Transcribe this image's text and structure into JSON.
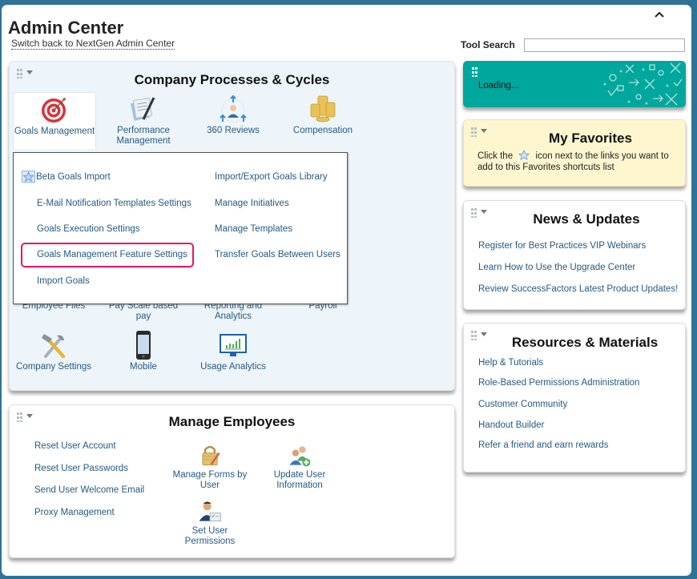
{
  "header": {
    "title": "Admin Center",
    "switch_link": "Switch back to NextGen Admin Center",
    "tool_search_label": "Tool Search",
    "tool_search_value": "",
    "collapse_icon": "chevron-up-icon"
  },
  "company_processes": {
    "title": "Company Processes & Cycles",
    "tiles": [
      {
        "label": "Goals Management",
        "icon": "target-icon",
        "active": true
      },
      {
        "label": "Performance Management",
        "icon": "document-pen-icon"
      },
      {
        "label": "360 Reviews",
        "icon": "people-network-icon"
      },
      {
        "label": "Compensation",
        "icon": "coins-icon"
      },
      {
        "label": "Employee Files",
        "icon": "employee-files-icon"
      },
      {
        "label": "Pay Scale based pay",
        "icon": "pay-scale-icon"
      },
      {
        "label": "Reporting and Analytics",
        "icon": "reporting-icon"
      },
      {
        "label": "Payroll",
        "icon": "payroll-icon"
      },
      {
        "label": "Company Settings",
        "icon": "tools-icon"
      },
      {
        "label": "Mobile",
        "icon": "mobile-phone-icon"
      },
      {
        "label": "Usage Analytics",
        "icon": "monitor-chart-icon"
      }
    ],
    "dropdown": {
      "left": [
        "Beta Goals Import",
        "E-Mail Notification Templates Settings",
        "Goals Execution Settings",
        "Goals Management Feature Settings",
        "Import Goals"
      ],
      "right": [
        "Import/Export Goals Library",
        "Manage Initiatives",
        "Manage Templates",
        "Transfer Goals Between Users"
      ],
      "highlighted": "Goals Management Feature Settings",
      "highlight_color": "#e8175d"
    }
  },
  "manage_employees": {
    "title": "Manage Employees",
    "links": [
      "Reset User Account",
      "Reset User Passwords",
      "Send User Welcome Email",
      "Proxy Management"
    ],
    "tiles": [
      {
        "label": "Manage Forms by User",
        "icon": "lock-pencil-icon"
      },
      {
        "label": "Update User Information",
        "icon": "users-add-icon"
      },
      {
        "label": "Set User Permissions",
        "icon": "user-permissions-icon"
      }
    ]
  },
  "loading_panel": {
    "text": "Loading..."
  },
  "favorites": {
    "title": "My Favorites",
    "text_before": "Click the",
    "text_after": "icon next to the links you want to add to this Favorites shortcuts list"
  },
  "news": {
    "title": "News & Updates",
    "links": [
      "Register for Best Practices VIP Webinars",
      "Learn How to Use the Upgrade Center",
      "Review SuccessFactors Latest Product Updates!"
    ]
  },
  "resources": {
    "title": "Resources & Materials",
    "links": [
      "Help & Tutorials",
      "Role-Based Permissions Administration",
      "Customer Community",
      "Handout Builder",
      "Refer a friend and earn rewards"
    ]
  },
  "colors": {
    "frame": "#2e7396",
    "link": "#245a82",
    "loading_bg": "#00a79d",
    "favorites_bg": "#fef6cf",
    "processes_bg": "#eef5fa"
  }
}
